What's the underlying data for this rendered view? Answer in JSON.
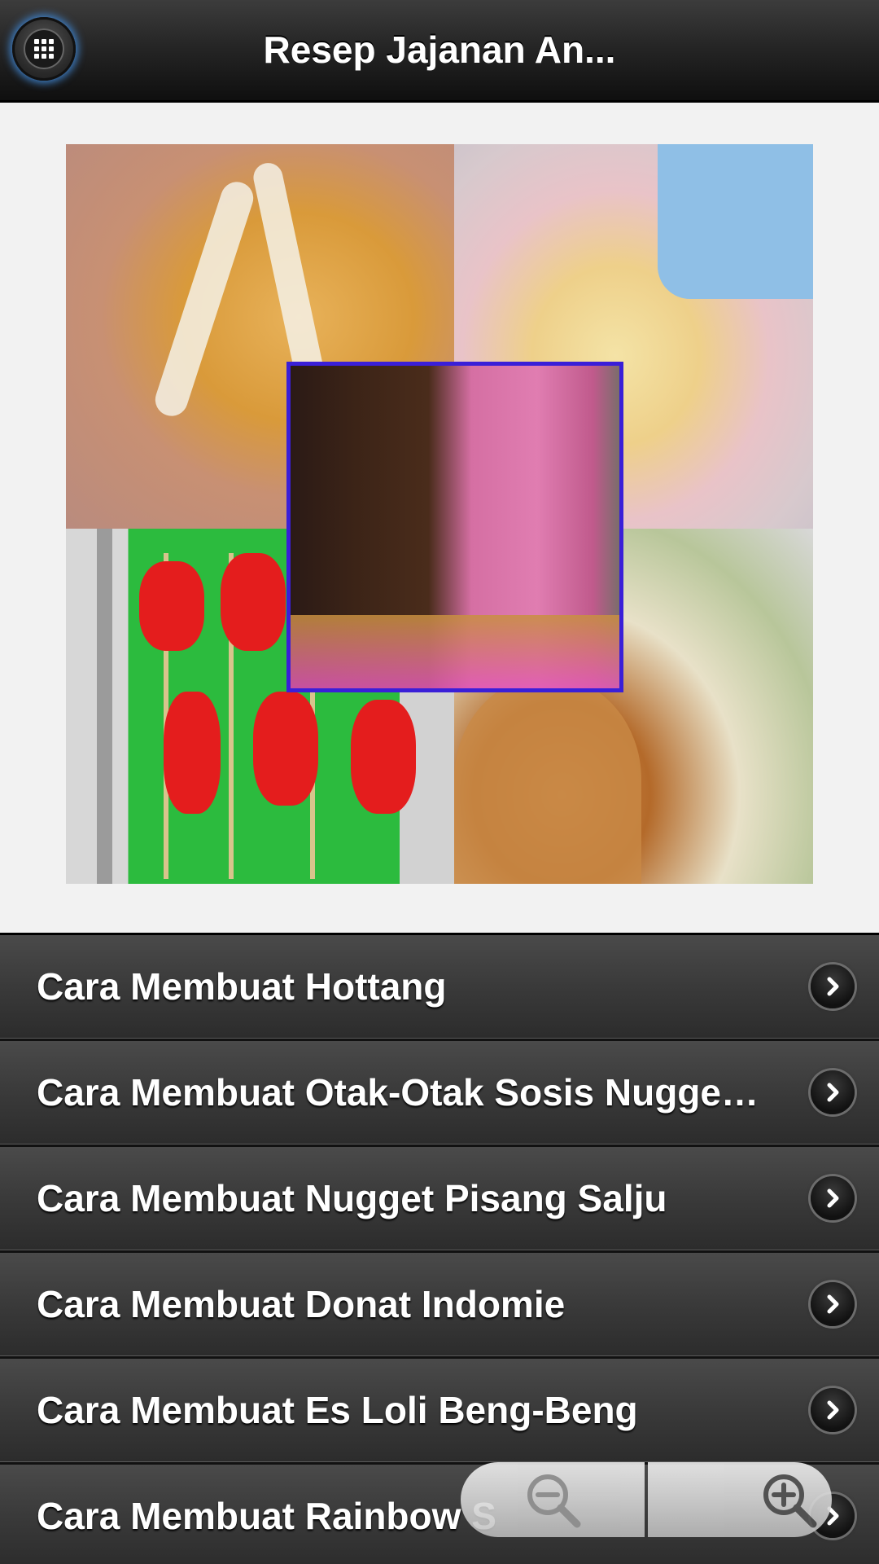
{
  "app": {
    "title": "Resep Jajanan An..."
  },
  "header": {
    "menu_icon": "grid-menu-icon"
  },
  "hero": {
    "image_name": "food-collage-image"
  },
  "list": {
    "items": [
      {
        "label": "Cara Membuat Hottang"
      },
      {
        "label": "Cara Membuat Otak-Otak Sosis Nugget ..."
      },
      {
        "label": "Cara Membuat Nugget Pisang Salju"
      },
      {
        "label": "Cara Membuat Donat Indomie"
      },
      {
        "label": "Cara Membuat Es Loli Beng-Beng"
      },
      {
        "label": "Cara Membuat Rainbow S"
      }
    ],
    "chevron_icon": "chevron-right-icon"
  },
  "zoom": {
    "zoom_out_icon": "zoom-out-icon",
    "zoom_in_icon": "zoom-in-icon"
  },
  "colors": {
    "header_bg": "#1c1c1c",
    "list_item_bg": "#3a3a3a",
    "text": "#ffffff",
    "page_bg": "#f2f2f2",
    "frame_border": "#3a1fd8"
  }
}
